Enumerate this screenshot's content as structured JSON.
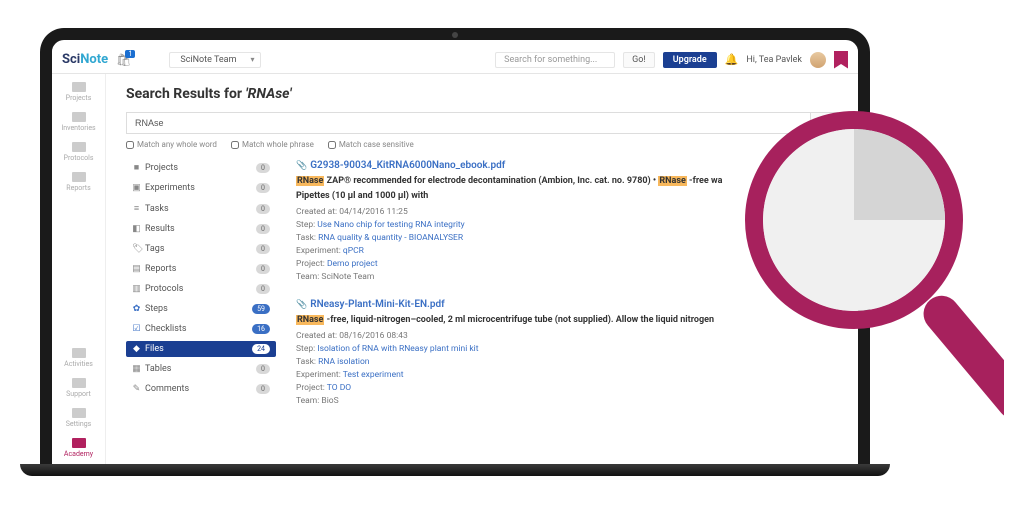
{
  "header": {
    "logo_a": "Sci",
    "logo_b": "Note",
    "notif_count": "1",
    "team": "SciNote Team",
    "search_placeholder": "Search for something...",
    "go": "Go!",
    "upgrade": "Upgrade",
    "greeting": "Hi, Tea Pavlek"
  },
  "rail": {
    "projects": "Projects",
    "inventories": "Inventories",
    "protocols": "Protocols",
    "reports": "Reports",
    "activities": "Activities",
    "support": "Support",
    "settings": "Settings",
    "academy": "Academy"
  },
  "search": {
    "heading_prefix": "Search Results for ",
    "term_quoted": "'RNAse'",
    "input_value": "RNAse",
    "chk_word": "Match any whole word",
    "chk_phrase": "Match whole phrase",
    "chk_case": "Match case sensitive"
  },
  "facets": [
    {
      "icon": "■",
      "label": "Projects",
      "count": "0",
      "cls": ""
    },
    {
      "icon": "▣",
      "label": "Experiments",
      "count": "0",
      "cls": ""
    },
    {
      "icon": "≡",
      "label": "Tasks",
      "count": "0",
      "cls": ""
    },
    {
      "icon": "◧",
      "label": "Results",
      "count": "0",
      "cls": ""
    },
    {
      "icon": "🏷",
      "label": "Tags",
      "count": "0",
      "cls": ""
    },
    {
      "icon": "▤",
      "label": "Reports",
      "count": "0",
      "cls": ""
    },
    {
      "icon": "▥",
      "label": "Protocols",
      "count": "0",
      "cls": ""
    },
    {
      "icon": "✿",
      "label": "Steps",
      "count": "59",
      "cls": "gear"
    },
    {
      "icon": "☑",
      "label": "Checklists",
      "count": "16",
      "cls": "check"
    },
    {
      "icon": "◆",
      "label": "Files",
      "count": "24",
      "cls": "active"
    },
    {
      "icon": "▦",
      "label": "Tables",
      "count": "0",
      "cls": ""
    },
    {
      "icon": "✎",
      "label": "Comments",
      "count": "0",
      "cls": ""
    }
  ],
  "results": [
    {
      "title": "G2938-90034_KitRNA6000Nano_ebook.pdf",
      "pre1": "",
      "hl1": "RNase",
      "mid1": " ZAP® recommended for electrode decontamination (Ambion, Inc. cat. no. 9780) • ",
      "hl2": "RNase",
      "post1": " -free wa",
      "line2": "Pipettes (10 µl and 1000 µl) with",
      "created": "Created at: 04/14/2016 11:25",
      "step_l": "Step: ",
      "step_v": "Use Nano chip for testing RNA integrity",
      "task_l": "Task: ",
      "task_v": "RNA quality & quantity - BIOANALYSER",
      "exp_l": "Experiment: ",
      "exp_v": "qPCR",
      "proj_l": "Project: ",
      "proj_v": "Demo project",
      "team_l": "Team: ",
      "team_v": "SciNote Team"
    },
    {
      "title": "RNeasy-Plant-Mini-Kit-EN.pdf",
      "pre1": "",
      "hl1": "RNase",
      "mid1": " -free, liquid-nitrogen–cooled, 2 ml microcentrifuge tube (not supplied). Allow the liquid nitrogen",
      "hl2": "",
      "post1": "",
      "line2": "",
      "created": "Created at: 08/16/2016 08:43",
      "step_l": "Step: ",
      "step_v": "Isolation of RNA with RNeasy plant mini kit",
      "task_l": "Task: ",
      "task_v": "RNA isolation",
      "exp_l": "Experiment: ",
      "exp_v": "Test experiment",
      "proj_l": "Project: ",
      "proj_v": "TO DO",
      "team_l": "Team: ",
      "team_v": "BioS"
    }
  ]
}
